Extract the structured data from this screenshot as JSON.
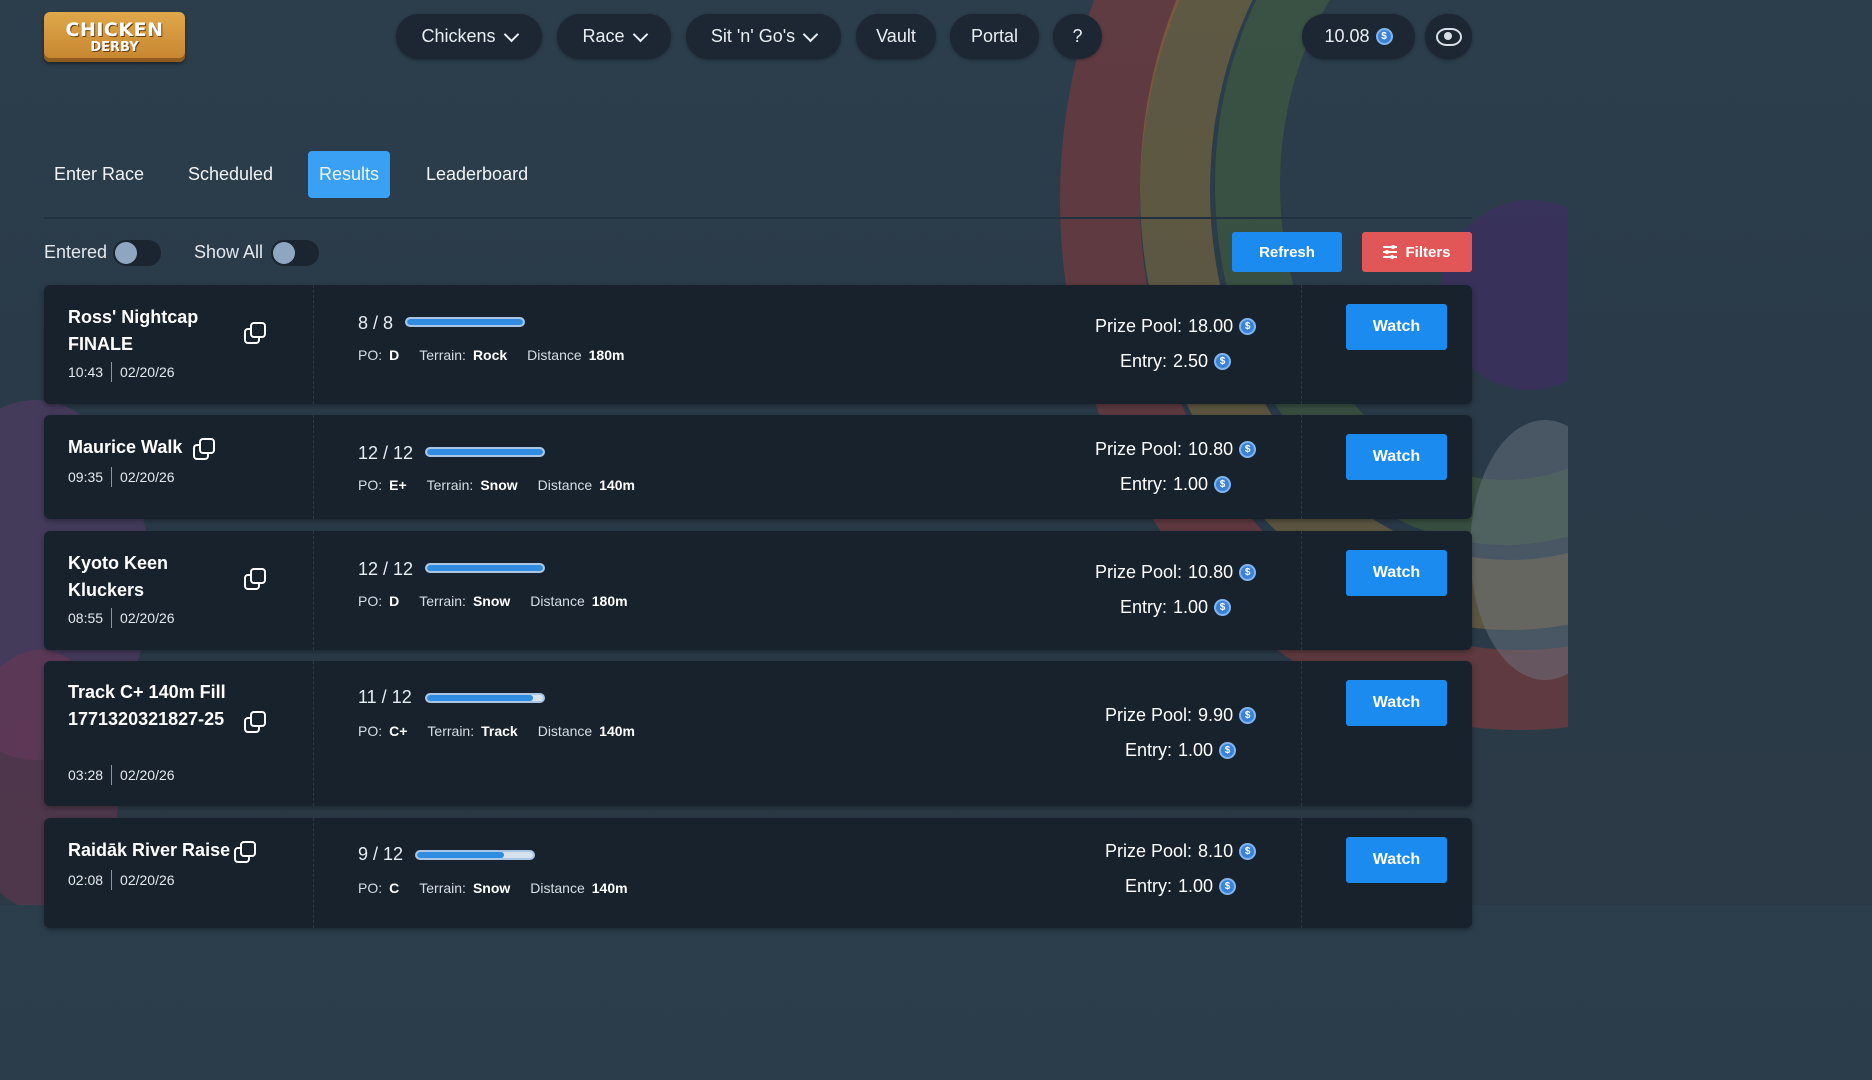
{
  "header": {
    "logo_line1": "CHICKEN",
    "logo_line2": "DERBY",
    "nav": {
      "chickens": "Chickens",
      "race": "Race",
      "sitngos": "Sit 'n' Go's",
      "vault": "Vault",
      "portal": "Portal",
      "help": "?"
    },
    "balance": "10.08"
  },
  "tabs": {
    "enter_race": "Enter Race",
    "scheduled": "Scheduled",
    "results": "Results",
    "leaderboard": "Leaderboard",
    "active": "Results"
  },
  "filters": {
    "entered_label": "Entered",
    "entered_on": false,
    "show_all_label": "Show All",
    "show_all_on": false,
    "refresh_label": "Refresh",
    "filters_label": "Filters"
  },
  "labels": {
    "po": "PO:",
    "terrain": "Terrain:",
    "distance": "Distance",
    "prize_pool": "Prize Pool:",
    "entry": "Entry:",
    "watch": "Watch"
  },
  "races": [
    {
      "name": "Ross' Nightcap FINALE",
      "time": "10:43",
      "date": "02/20/26",
      "count": "8 / 8",
      "fill": 1.0,
      "po": "D",
      "terrain": "Rock",
      "distance": "180m",
      "prize_pool": "18.00",
      "entry": "2.50"
    },
    {
      "name": "Maurice Walk",
      "time": "09:35",
      "date": "02/20/26",
      "count": "12 / 12",
      "fill": 1.0,
      "po": "E+",
      "terrain": "Snow",
      "distance": "140m",
      "prize_pool": "10.80",
      "entry": "1.00"
    },
    {
      "name": "Kyoto Keen Kluckers",
      "time": "08:55",
      "date": "02/20/26",
      "count": "12 / 12",
      "fill": 1.0,
      "po": "D",
      "terrain": "Snow",
      "distance": "180m",
      "prize_pool": "10.80",
      "entry": "1.00"
    },
    {
      "name": "Track C+ 140m Fill 1771320321827-25",
      "time": "03:28",
      "date": "02/20/26",
      "count": "11 / 12",
      "fill": 0.917,
      "po": "C+",
      "terrain": "Track",
      "distance": "140m",
      "prize_pool": "9.90",
      "entry": "1.00"
    },
    {
      "name": "Raidāk River Raise",
      "time": "02:08",
      "date": "02/20/26",
      "count": "9 / 12",
      "fill": 0.75,
      "po": "C",
      "terrain": "Snow",
      "distance": "140m",
      "prize_pool": "8.10",
      "entry": "1.00"
    }
  ]
}
